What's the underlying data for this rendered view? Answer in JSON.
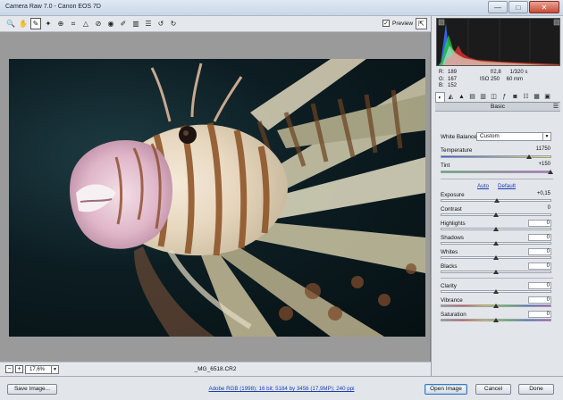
{
  "window": {
    "title": "Camera Raw 7.0  -  Canon EOS 7D",
    "controls": [
      "—",
      "□",
      "✕"
    ]
  },
  "toolbar": {
    "tools": [
      {
        "name": "zoom-tool-icon",
        "glyph": "🔍"
      },
      {
        "name": "hand-tool-icon",
        "glyph": "✋"
      },
      {
        "name": "white-balance-tool-icon",
        "glyph": "✎"
      },
      {
        "name": "color-sampler-tool-icon",
        "glyph": "✦"
      },
      {
        "name": "targeted-adjustment-tool-icon",
        "glyph": "⊕"
      },
      {
        "name": "crop-tool-icon",
        "glyph": "⌗"
      },
      {
        "name": "straighten-tool-icon",
        "glyph": "△"
      },
      {
        "name": "spot-removal-tool-icon",
        "glyph": "⊘"
      },
      {
        "name": "red-eye-tool-icon",
        "glyph": "◉"
      },
      {
        "name": "adjustment-brush-icon",
        "glyph": "✐"
      },
      {
        "name": "graduated-filter-icon",
        "glyph": "▥"
      },
      {
        "name": "preferences-icon",
        "glyph": "☰"
      },
      {
        "name": "rotate-ccw-icon",
        "glyph": "↺"
      },
      {
        "name": "rotate-cw-icon",
        "glyph": "↻"
      }
    ],
    "preview_label": "Preview",
    "preview_checked": "✓"
  },
  "canvas": {
    "zoom": "17,6%",
    "filename": "_MG_6518.CR2"
  },
  "readout": {
    "r_label": "R:",
    "r_value": "189",
    "g_label": "G:",
    "g_value": "167",
    "b_label": "B:",
    "b_value": "152",
    "aperture": "f/2,8",
    "shutter": "1/320 s",
    "iso": "ISO 250",
    "focal": "60 mm"
  },
  "panel": {
    "heading": "Basic",
    "white_balance_label": "White Balance:",
    "white_balance_value": "Custom",
    "temperature_label": "Temperature",
    "temperature_value": "11750",
    "tint_label": "Tint",
    "tint_value": "+150",
    "auto_link": "Auto",
    "default_link": "Default",
    "exposure_label": "Exposure",
    "exposure_value": "+0,15",
    "contrast_label": "Contrast",
    "contrast_value": "0",
    "highlights_label": "Highlights",
    "highlights_value": "0",
    "shadows_label": "Shadows",
    "shadows_value": "0",
    "whites_label": "Whites",
    "whites_value": "0",
    "blacks_label": "Blacks",
    "blacks_value": "0",
    "clarity_label": "Clarity",
    "clarity_value": "0",
    "vibrance_label": "Vibrance",
    "vibrance_value": "0",
    "saturation_label": "Saturation",
    "saturation_value": "0"
  },
  "bottom": {
    "save_image": "Save Image...",
    "workflow": "Adobe RGB (1998); 16 bit; 5184 by 3456 (17,9MP); 240 ppi",
    "open_image": "Open Image",
    "cancel": "Cancel",
    "done": "Done"
  }
}
